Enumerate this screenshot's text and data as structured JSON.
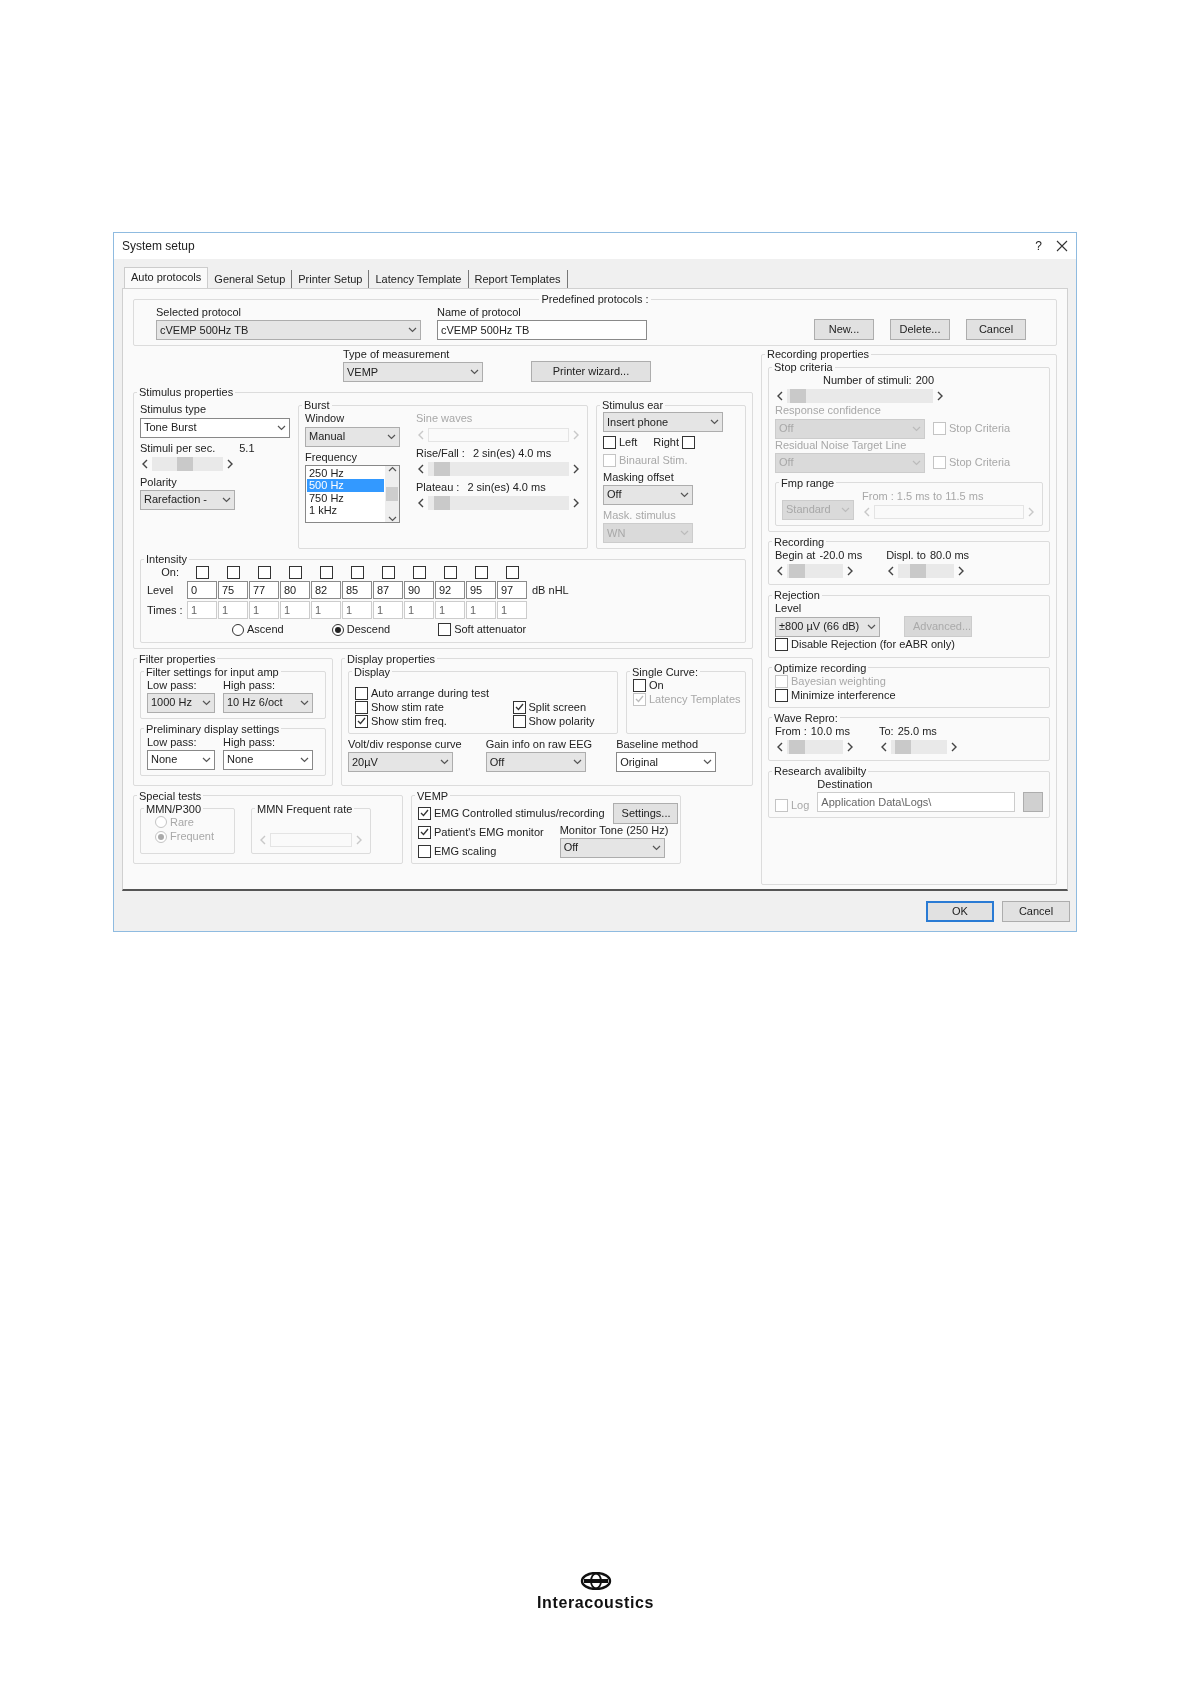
{
  "window": {
    "title": "System setup",
    "help": "?"
  },
  "tabs": [
    {
      "label": "Auto protocols",
      "selected": true
    },
    {
      "label": "General Setup",
      "selected": false
    },
    {
      "label": "Printer Setup",
      "selected": false
    },
    {
      "label": "Latency Template",
      "selected": false
    },
    {
      "label": "Report Templates",
      "selected": false
    }
  ],
  "predefined_protocols": {
    "legend": "Predefined protocols :",
    "selected_protocol": {
      "label": "Selected protocol",
      "value": "cVEMP 500Hz TB"
    },
    "name_of_protocol": {
      "label": "Name of protocol",
      "value": "cVEMP 500Hz TB"
    },
    "buttons": [
      {
        "label": "New..."
      },
      {
        "label": "Delete..."
      },
      {
        "label": "Cancel"
      }
    ]
  },
  "type_of_measurement": {
    "label": "Type of measurement",
    "value": "VEMP"
  },
  "printer_wizard": {
    "label": "Printer wizard..."
  },
  "stimulus_properties": {
    "legend": "Stimulus properties",
    "stimulus_type": {
      "label": "Stimulus type",
      "value": "Tone Burst"
    },
    "stimuli_per_sec": {
      "label": "Stimuli per sec.",
      "value": "5.1",
      "level": 0.45
    },
    "polarity": {
      "label": "Polarity",
      "value": "Rarefaction -"
    },
    "burst": {
      "legend": "Burst",
      "window": {
        "label": "Window",
        "value": "Manual"
      },
      "frequency": {
        "label": "Frequency",
        "items": [
          {
            "text": "250 Hz",
            "selected": false
          },
          {
            "text": "500 Hz",
            "selected": true
          },
          {
            "text": "750 Hz",
            "selected": false
          },
          {
            "text": "1 kHz",
            "selected": false
          }
        ]
      },
      "sine_waves": {
        "label": "Sine waves",
        "disabled": true
      },
      "rise_fall": {
        "label": "Rise/Fall :",
        "value": "2 sin(es) 4.0 ms",
        "level": 0.05
      },
      "plateau": {
        "label": "Plateau :",
        "value": "2 sin(es) 4.0 ms",
        "level": 0.05
      }
    },
    "stimulus_ear": {
      "legend": "Stimulus ear",
      "value": "Insert phone",
      "left": {
        "label": "Left",
        "checked": false
      },
      "right": {
        "label": "Right",
        "checked": false
      },
      "binaural": {
        "label": "Binaural Stim.",
        "checked": false,
        "disabled": true
      },
      "masking_offset": {
        "label": "Masking offset",
        "value": "Off"
      },
      "mask_stimulus": {
        "label": "Mask. stimulus",
        "value": "WN",
        "disabled": true
      }
    },
    "intensity": {
      "legend": "Intensity",
      "on_label": "On:",
      "db_label": "Level",
      "times_label": "Times :",
      "unit": "dB nHL",
      "steps": [
        {
          "on": false,
          "db": "0",
          "times": "1"
        },
        {
          "on": false,
          "db": "75",
          "times": "1"
        },
        {
          "on": false,
          "db": "77",
          "times": "1"
        },
        {
          "on": false,
          "db": "80",
          "times": "1"
        },
        {
          "on": false,
          "db": "82",
          "times": "1"
        },
        {
          "on": false,
          "db": "85",
          "times": "1"
        },
        {
          "on": false,
          "db": "87",
          "times": "1"
        },
        {
          "on": false,
          "db": "90",
          "times": "1"
        },
        {
          "on": false,
          "db": "92",
          "times": "1"
        },
        {
          "on": false,
          "db": "95",
          "times": "1"
        },
        {
          "on": false,
          "db": "97",
          "times": "1"
        }
      ],
      "order": [
        {
          "label": "Ascend",
          "selected": false
        },
        {
          "label": "Descend",
          "selected": true
        }
      ],
      "soft_attenuator": {
        "label": "Soft attenuator",
        "checked": false
      }
    }
  },
  "filter_properties": {
    "legend": "Filter properties",
    "input_amp": {
      "legend": "Filter settings for input amp",
      "low_pass": {
        "label": "Low pass:",
        "value": "1000 Hz"
      },
      "high_pass": {
        "label": "High pass:",
        "value": "10 Hz 6/oct"
      }
    },
    "preliminary": {
      "legend": "Preliminary display settings",
      "low_pass": {
        "label": "Low pass:",
        "value": "None"
      },
      "high_pass": {
        "label": "High pass:",
        "value": "None"
      }
    }
  },
  "display_properties": {
    "legend": "Display properties",
    "display": {
      "legend": "Display",
      "options": [
        {
          "label": "Auto arrange during test",
          "checked": false
        },
        {
          "label": "Show stim rate",
          "checked": false
        },
        {
          "label": "Split screen",
          "checked": true
        },
        {
          "label": "Show stim freq.",
          "checked": true
        },
        {
          "label": "Show polarity",
          "checked": false
        }
      ]
    },
    "single_curve": {
      "legend": "Single Curve:",
      "on": {
        "label": "On",
        "checked": false
      },
      "latency_templates": {
        "label": "Latency Templates",
        "checked": true,
        "disabled": true
      }
    },
    "volt_div": {
      "label": "Volt/div response curve",
      "value": "20µV"
    },
    "gain_info": {
      "label": "Gain info on raw EEG",
      "value": "Off"
    },
    "baseline": {
      "label": "Baseline method",
      "value": "Original"
    }
  },
  "special_tests": {
    "legend": "Special tests",
    "mmn_p300": {
      "legend": "MMN/P300",
      "options": [
        {
          "label": "Rare",
          "selected": false,
          "disabled": true
        },
        {
          "label": "Frequent",
          "selected": true,
          "disabled": true
        }
      ]
    },
    "mmn_rate": {
      "legend": "MMN Frequent rate",
      "disabled": true
    }
  },
  "vemp": {
    "legend": "VEMP",
    "emg_controlled": {
      "label": "EMG Controlled stimulus/recording",
      "checked": true
    },
    "settings": {
      "label": "Settings..."
    },
    "emg_monitor": {
      "label": "Patient's EMG monitor",
      "checked": true
    },
    "emg_scaling": {
      "label": "EMG scaling",
      "checked": false
    },
    "monitor_tone": {
      "label": "Monitor Tone (250 Hz)",
      "value": "Off"
    }
  },
  "recording_properties": {
    "legend": "Recording properties",
    "stop_criteria": {
      "legend": "Stop criteria",
      "stimuli": {
        "label": "Number of stimuli:",
        "value": "200",
        "level": 0.02
      },
      "response_confidence": {
        "label": "Response confidence",
        "value": "Off",
        "disabled": true,
        "stop": {
          "label": "Stop Criteria",
          "checked": false,
          "disabled": true
        }
      },
      "residual_noise": {
        "label": "Residual Noise Target Line",
        "value": "Off",
        "disabled": true,
        "stop": {
          "label": "Stop Criteria",
          "checked": false,
          "disabled": true
        }
      },
      "fmp_range": {
        "legend": "Fmp range",
        "value": "Standard",
        "disabled": true,
        "range": {
          "label": "From : 1.5 ms to 11.5 ms",
          "disabled": true
        }
      }
    },
    "recording": {
      "legend": "Recording",
      "begin": {
        "label": "Begin at",
        "value": "-20.0 ms",
        "level": 0.05
      },
      "displ": {
        "label": "Displ. to",
        "value": "80.0 ms",
        "level": 0.3
      }
    },
    "rejection": {
      "legend": "Rejection",
      "level_label": "Level",
      "value": "±800 µV (66 dB)",
      "advanced": {
        "label": "Advanced...",
        "disabled": true
      },
      "disable": {
        "label": "Disable Rejection (for eABR only)",
        "checked": false
      }
    },
    "optimize": {
      "legend": "Optimize recording",
      "options": [
        {
          "label": "Bayesian weighting",
          "checked": false,
          "disabled": true
        },
        {
          "label": "Minimize interference",
          "checked": false,
          "disabled": false
        }
      ]
    },
    "wave_repro": {
      "legend": "Wave Repro:",
      "from": {
        "label": "From :",
        "value": "10.0 ms",
        "level": 0.05
      },
      "to": {
        "label": "To:",
        "value": "25.0 ms",
        "level": 0.1
      }
    },
    "research": {
      "legend": "Research avalibilty",
      "log": {
        "label": "Log",
        "checked": false,
        "disabled": true
      },
      "destination": {
        "label": "Destination",
        "value": "Application Data\\Logs\\"
      }
    }
  },
  "footer_buttons": [
    {
      "label": "OK",
      "default": true
    },
    {
      "label": "Cancel",
      "default": false
    }
  ],
  "logo": {
    "text": "Interacoustics"
  }
}
